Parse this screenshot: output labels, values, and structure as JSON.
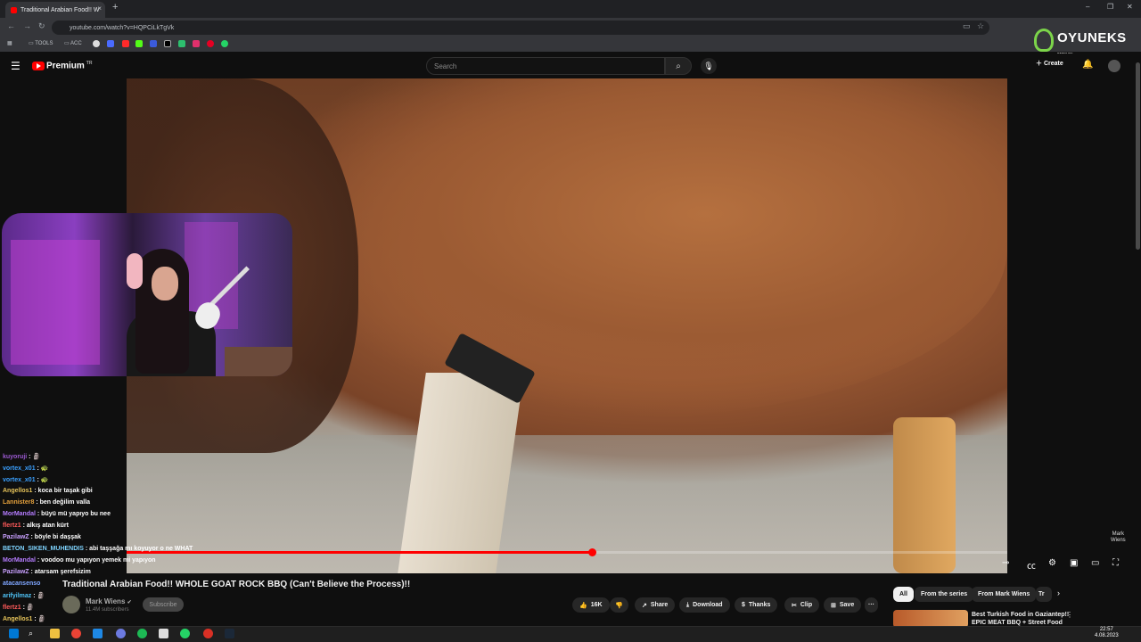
{
  "browser": {
    "tab_title": "Traditional Arabian Food!! W",
    "tab_close": "×",
    "new_tab": "+",
    "url": "youtube.com/watch?v=HQPCiLkTgVk",
    "bookmarks": [
      "TOOLS",
      "ACC"
    ],
    "window_min": "–",
    "window_max": "❐",
    "window_close": "✕"
  },
  "youtube": {
    "brand": "Premium",
    "brand_sup": "TR",
    "search_placeholder": "Search",
    "create_label": "Create",
    "video_title": "Traditional Arabian Food!! WHOLE GOAT ROCK BBQ (Can't Believe the Process)!!",
    "channel_name": "Mark Wiens",
    "subscribers": "11.4M subscribers",
    "subscribe_label": "Subscribe",
    "likes": "16K",
    "share_label": "Share",
    "download_label": "Download",
    "thanks_label": "Thanks",
    "clip_label": "Clip",
    "save_label": "Save",
    "more_label": "···",
    "progress_fraction": 0.528,
    "watermark": [
      "Mark",
      "Wiens"
    ],
    "chips": [
      "All",
      "From the series",
      "From Mark Wiens",
      "Tr"
    ],
    "rec_title": "Best Turkish Food in Gaziantep!! EPIC MEAT BBQ + Street Food"
  },
  "chat": [
    {
      "user": "kuyoruji",
      "color": "#9b59d0",
      "msg": ": 🗿"
    },
    {
      "user": "vortex_x01",
      "color": "#3aa0ff",
      "msg": ": 🐢"
    },
    {
      "user": "vortex_x01",
      "color": "#3aa0ff",
      "msg": ": 🐢"
    },
    {
      "user": "Angellos1",
      "color": "#e6c35a",
      "msg": ": koca bir taşak gibi"
    },
    {
      "user": "Lannister8",
      "color": "#e6a23c",
      "msg": ": ben değilim valla"
    },
    {
      "user": "MorMandal",
      "color": "#b57cff",
      "msg": ": büyü mü yapıyo bu nee"
    },
    {
      "user": "flertz1",
      "color": "#ff5a5a",
      "msg": ": alkış atan kürt"
    },
    {
      "user": "PazilawZ",
      "color": "#c9a0ff",
      "msg": ": böyle bi daşşak"
    },
    {
      "user": "BETON_SIKEN_MUHENDIS",
      "color": "#7fd4ff",
      "msg": ": abi taşşağa mı koyuyor o ne WHAT"
    },
    {
      "user": "MorMandal",
      "color": "#b57cff",
      "msg": ": voodoo mu yapıyon yemek mi yapıyon"
    },
    {
      "user": "PazilawZ",
      "color": "#c9a0ff",
      "msg": ": atarsam şerefsizim"
    },
    {
      "user": "atacansenso",
      "color": "#7fa6ff",
      "msg": ""
    },
    {
      "user": "arifyilmaz",
      "color": "#4fc3f7",
      "msg": ": 🗿"
    },
    {
      "user": "flertz1",
      "color": "#ff5a5a",
      "msg": ": 🗿"
    },
    {
      "user": "Angellos1",
      "color": "#e6c35a",
      "msg": ": 🗿"
    }
  ],
  "watermark": {
    "brand": "OYUNEKS",
    "sub": "www.oy"
  },
  "taskbar": {
    "time": "22:57",
    "date": "4.08.2023"
  },
  "colors": {
    "yt_red": "#ff0000",
    "bg": "#0f0f0f"
  }
}
